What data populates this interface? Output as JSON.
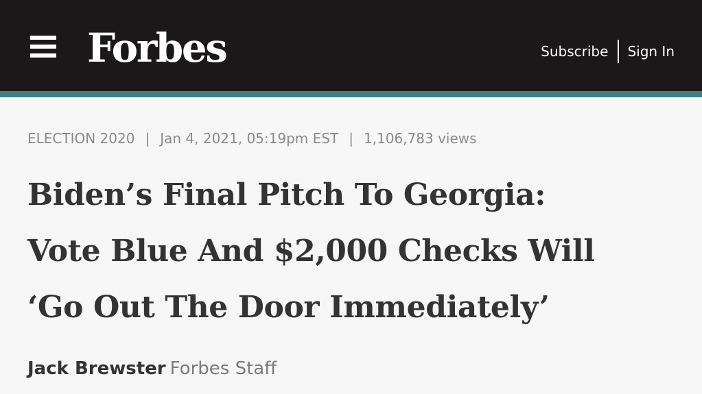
{
  "header": {
    "logo": "Forbes",
    "subscribe_label": "Subscribe",
    "signin_label": "Sign In"
  },
  "colors": {
    "header_background": "#1a1818",
    "accent_line": "#3e7f8b",
    "page_background": "#f7f7f7"
  },
  "icons": {
    "menu": "hamburger-menu-icon"
  },
  "article": {
    "channel": "ELECTION 2020",
    "date": "Jan 4, 2021, 05:19pm EST",
    "views": "1,106,783 views",
    "headline_lines": [
      "Biden’s Final Pitch To Georgia:",
      "Vote Blue And $2,000 Checks Will",
      "‘Go Out The Door Immediately’"
    ],
    "author": "Jack Brewster",
    "author_role": "Forbes Staff"
  }
}
